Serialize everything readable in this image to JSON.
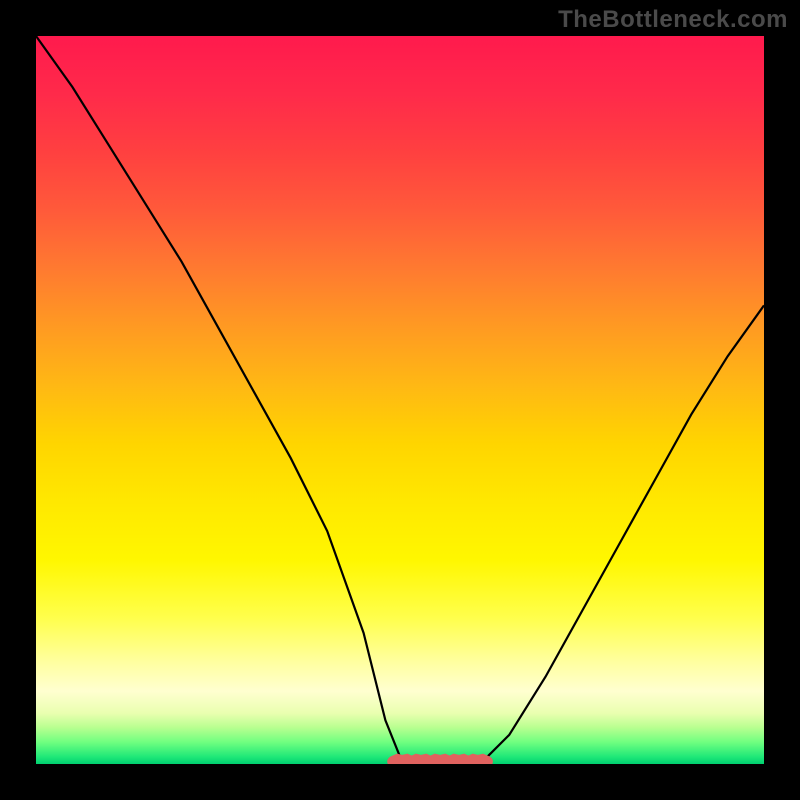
{
  "watermark": "TheBottleneck.com",
  "chart_data": {
    "type": "line",
    "title": "",
    "xlabel": "",
    "ylabel": "",
    "xlim": [
      0,
      100
    ],
    "ylim": [
      0,
      100
    ],
    "x": [
      0,
      5,
      10,
      15,
      20,
      25,
      30,
      35,
      40,
      45,
      48,
      50,
      52,
      55,
      58,
      60,
      62,
      65,
      70,
      75,
      80,
      85,
      90,
      95,
      100
    ],
    "values": [
      100,
      93,
      85,
      77,
      69,
      60,
      51,
      42,
      32,
      18,
      6,
      1,
      0,
      0,
      0,
      0,
      1,
      4,
      12,
      21,
      30,
      39,
      48,
      56,
      63
    ],
    "marker_region": {
      "x_start": 49,
      "x_end": 62,
      "y": 0
    },
    "gradient_stops": [
      {
        "pos": 0.0,
        "color": "#ff1a4d"
      },
      {
        "pos": 0.5,
        "color": "#ffd500"
      },
      {
        "pos": 0.9,
        "color": "#ffffd0"
      },
      {
        "pos": 1.0,
        "color": "#00d070"
      }
    ],
    "curve_color": "#000000",
    "marker_color": "#e0625f"
  }
}
